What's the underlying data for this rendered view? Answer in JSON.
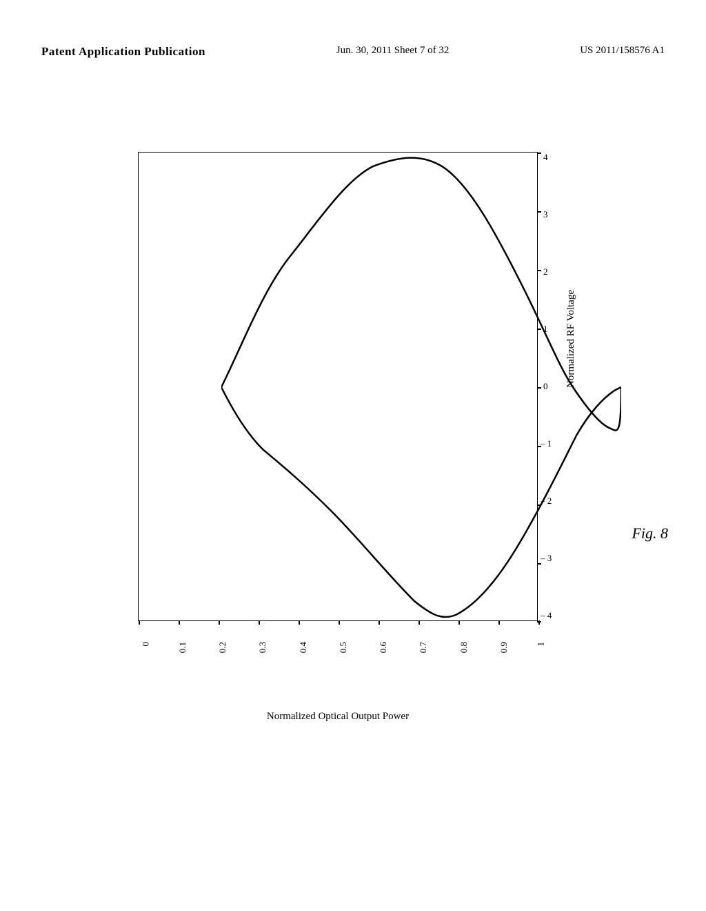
{
  "header": {
    "left": "Patent Application Publication",
    "center": "Jun. 30, 2011   Sheet 7 of 32",
    "right": "US 2011/158576 A1"
  },
  "chart": {
    "x_axis_title": "Normalized RF Voltage",
    "y_axis_title": "Normalized Optical Output Power",
    "x_tick_labels": [
      "4",
      "3",
      "2",
      "1",
      "0",
      "– 1",
      "– 2",
      "– 3",
      "– 4"
    ],
    "y_tick_labels": [
      "0",
      "0.1",
      "0.2",
      "0.3",
      "0.4",
      "0.5",
      "0.6",
      "0.7",
      "0.8",
      "0.9",
      "1"
    ],
    "fig_label": "Fig. 8"
  }
}
